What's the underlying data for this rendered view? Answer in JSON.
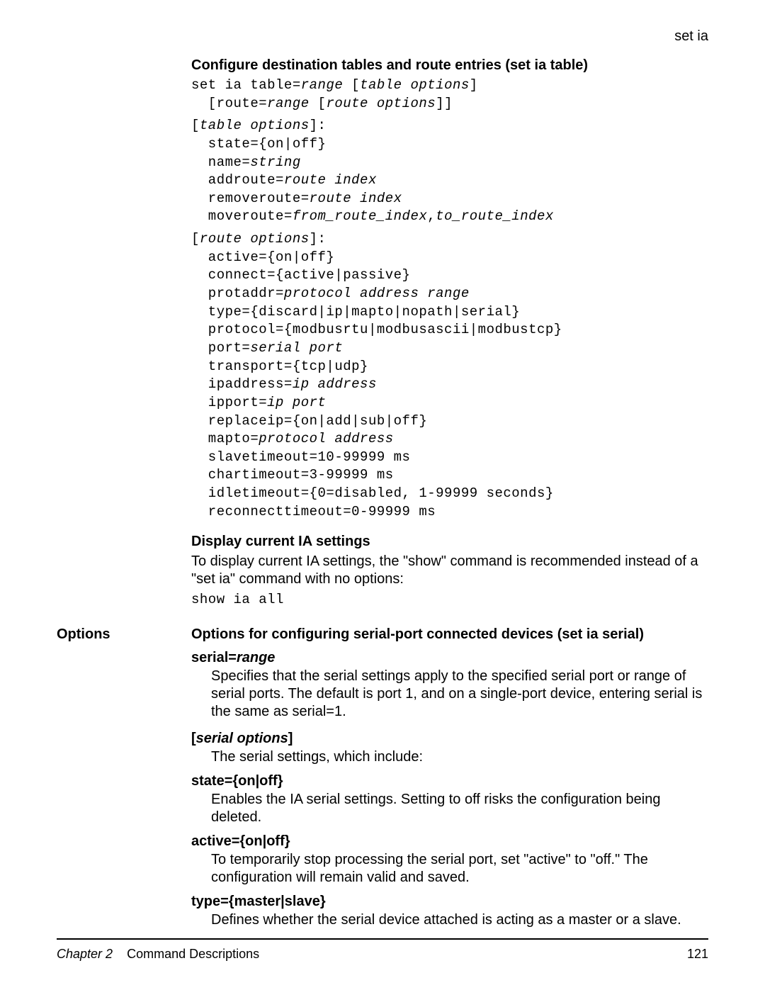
{
  "header": {
    "right": "set ia"
  },
  "sections": {
    "configure": {
      "heading": "Configure destination tables and route entries (set ia table)",
      "codeBlocks": {
        "block1_line1_text": "set ia table=",
        "block1_line1_italic": "range",
        "block1_line1_text2": " [",
        "block1_line1_italic2": "table options",
        "block1_line1_text3": "]",
        "block1_line2_pad": "  [route=",
        "block1_line2_italic": "range",
        "block1_line2_text2": " [",
        "block1_line2_italic2": "route options",
        "block1_line2_text3": "]]",
        "block2_line1_text": "[",
        "block2_line1_italic": "table options",
        "block2_line1_text2": "]:",
        "block2_line2": "  state={on|off}",
        "block2_line3_text": "  name=",
        "block2_line3_italic": "string",
        "block2_line4_text": "  addroute=",
        "block2_line4_italic": "route index",
        "block2_line5_text": "  removeroute=",
        "block2_line5_italic": "route index",
        "block2_line6_text": "  moveroute=",
        "block2_line6_italic": "from_route_index",
        "block2_line6_text2": ",",
        "block2_line6_italic2": "to_route_index",
        "block3_line1_text": "[",
        "block3_line1_italic": "route options",
        "block3_line1_text2": "]:",
        "block3_line2": "  active={on|off}",
        "block3_line3": "  connect={active|passive}",
        "block3_line4_text": "  protaddr=",
        "block3_line4_italic": "protocol address range",
        "block3_line5": "  type={discard|ip|mapto|nopath|serial}",
        "block3_line6": "  protocol={modbusrtu|modbusascii|modbustcp}",
        "block3_line7_text": "  port=",
        "block3_line7_italic": "serial port",
        "block3_line8": "  transport={tcp|udp}",
        "block3_line9_text": "  ipaddress=",
        "block3_line9_italic": "ip address",
        "block3_line10_text": "  ipport=",
        "block3_line10_italic": "ip port",
        "block3_line11": "  replaceip={on|add|sub|off}",
        "block3_line12_text": "  mapto=",
        "block3_line12_italic": "protocol address",
        "block3_line13": "  slavetimeout=10-99999 ms",
        "block3_line14": "  chartimeout=3-99999 ms",
        "block3_line15": "  idletimeout={0=disabled, 1-99999 seconds}",
        "block3_line16": "  reconnecttimeout=0-99999 ms"
      }
    },
    "display": {
      "heading": "Display current IA settings",
      "body": "To display current IA settings, the \"show\" command is recommended instead of a \"set ia\" command with no options:",
      "code": "show ia all"
    },
    "options": {
      "label": "Options",
      "heading": "Options for configuring serial-port connected devices (set ia serial)",
      "serial": {
        "title_plain": "serial=",
        "title_italic": "range",
        "desc": "Specifies that the serial settings apply to the specified serial port or range of serial ports. The default is port 1, and on a single-port device, entering serial is the same as serial=1."
      },
      "serialopts": {
        "title_b1": "[",
        "title_italic": "serial options",
        "title_b2": "]",
        "desc": "The serial settings, which include:"
      },
      "state": {
        "title": "state={on|off}",
        "desc": "Enables the IA serial settings. Setting to off risks the configuration being deleted."
      },
      "active": {
        "title": "active={on|off}",
        "desc": "To temporarily stop processing the serial port, set \"active\" to \"off.\" The configuration will remain valid and saved."
      },
      "type": {
        "title": "type={master|slave}",
        "desc": "Defines whether the serial device attached is acting as a master or a slave."
      }
    }
  },
  "footer": {
    "chapterLabel": "Chapter 2",
    "chapterTitle": "Command Descriptions",
    "page": "121"
  }
}
